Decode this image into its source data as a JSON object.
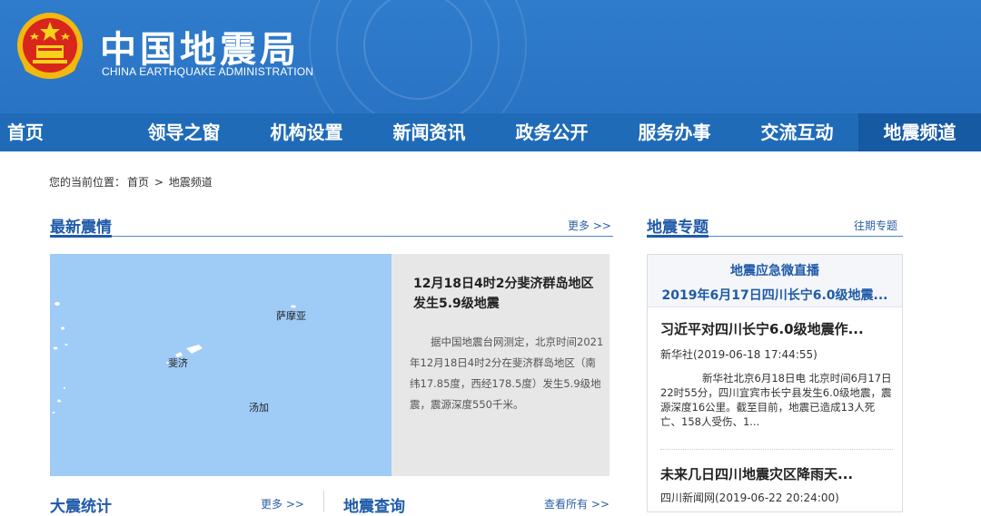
{
  "site": {
    "title": "中国地震局",
    "subtitle": "CHINA EARTHQUAKE ADMINISTRATION"
  },
  "nav": {
    "items": [
      "首页",
      "领导之窗",
      "机构设置",
      "新闻资讯",
      "政务公开",
      "服务办事",
      "交流互动",
      "地震频道"
    ],
    "active_index": 7
  },
  "breadcrumb": {
    "prefix": "您的当前位置：",
    "home": "首页",
    "separator": ">",
    "current": "地震频道"
  },
  "latest": {
    "heading": "最新震情",
    "more": "更多 >>",
    "map": {
      "labels": [
        "萨摩亚",
        "斐济",
        "汤加"
      ]
    },
    "event_title": "12月18日4时2分斐济群岛地区发生5.9级地震",
    "event_text": "据中国地震台网测定，北京时间2021年12月18日4时2分在斐济群岛地区（南纬17.85度，西经178.5度）发生5.9级地震，震源深度550千米。"
  },
  "special": {
    "heading": "地震专题",
    "more": "往期专题",
    "live_label": "地震应急微直播",
    "live_sub": "2019年6月17日四川长宁6.0级地震...",
    "news": [
      {
        "title": "习近平对四川长宁6.0级地震作...",
        "meta": "新华社(2019-06-18 17:44:55)",
        "body": "新华社北京6月18日电 北京时间6月17日22时55分，四川宜宾市长宁县发生6.0级地震，震源深度16公里。截至目前，地震已造成13人死亡、158人受伤、1..."
      },
      {
        "title": "未来几日四川地震灾区降雨天...",
        "meta": "四川新闻网(2019-06-22 20:24:00)"
      }
    ]
  },
  "stats": {
    "heading": "大震统计",
    "more": "更多 >>"
  },
  "query": {
    "heading": "地震查询",
    "more": "查看所有 >>"
  },
  "colors": {
    "header_blue": "#2a73c4",
    "nav_blue": "#1f6bb8",
    "heading_blue": "#1f5aa8",
    "map_sea": "#9fcbf7"
  }
}
